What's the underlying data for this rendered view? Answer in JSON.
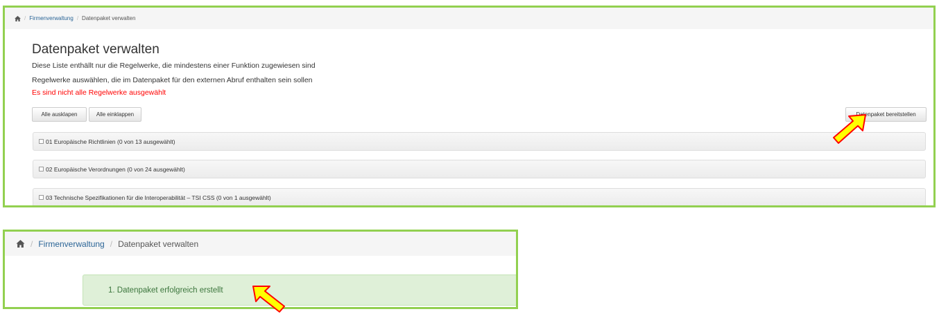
{
  "panel1": {
    "breadcrumb": {
      "home_icon": "home-icon",
      "items": [
        "Firmenverwaltung",
        "Datenpaket verwalten"
      ],
      "separator": "/"
    },
    "title": "Datenpaket verwalten",
    "description_line1": "Diese Liste enthällt nur die Regelwerke, die mindestens einer Funktion zugewiesen sind",
    "description_line2": "Regelwerke auswählen, die im Datenpaket für den externen Abruf enthalten sein sollen",
    "warning": "Es sind nicht alle Regelwerke ausgewählt",
    "buttons": {
      "expand_all": "Alle ausklapen",
      "collapse_all": "Alle einklappen",
      "provide_package": "Datenpaket bereitstellen"
    },
    "groups": [
      {
        "label": "01 Europäische Richtlinien (0 von 13 ausgewählt)"
      },
      {
        "label": "02 Europäische Verordnungen (0 von 24 ausgewählt)"
      },
      {
        "label": "03 Technische Spezifikationen für die Interoperabilität – TSI CSS (0 von 1 ausgewählt)"
      }
    ]
  },
  "panel2": {
    "breadcrumb": {
      "home_icon": "home-icon",
      "items": [
        "Firmenverwaltung",
        "Datenpaket verwalten"
      ],
      "separator": "/"
    },
    "alert": "1. Datenpaket erfolgreich erstellt"
  },
  "colors": {
    "frame_border": "#92d050",
    "warning_text": "#ff0000",
    "success_bg": "#dff0d8",
    "success_text": "#3c763d",
    "arrow_fill": "#ffff00",
    "arrow_stroke": "#ff0000",
    "link": "#2a6496"
  }
}
